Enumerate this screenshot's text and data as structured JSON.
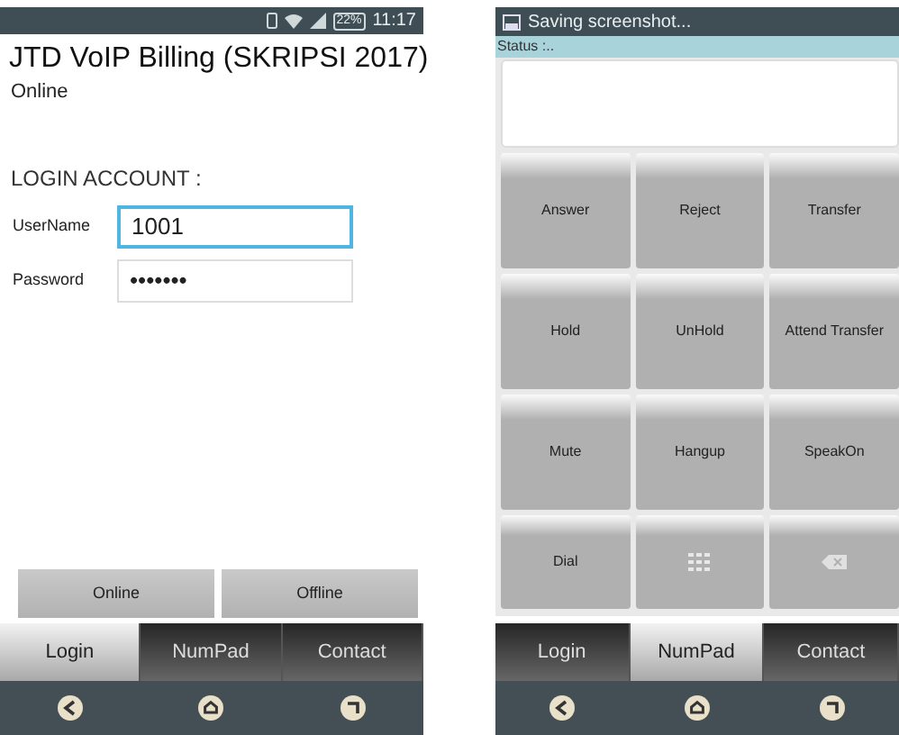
{
  "login_screen": {
    "status_bar": {
      "battery": "22%",
      "time": "11:17"
    },
    "title": "JTD VoIP Billing (SKRIPSI 2017)",
    "status": "Online",
    "section": "LOGIN ACCOUNT :",
    "fields": [
      {
        "label": "UserName",
        "value": "1001",
        "focused": true
      },
      {
        "label": "Password",
        "value": "•••••••",
        "focused": false
      }
    ],
    "buttons": [
      "Online",
      "Offline"
    ],
    "tabs": [
      {
        "label": "Login",
        "selected": true
      },
      {
        "label": "NumPad",
        "selected": false
      },
      {
        "label": "Contact",
        "selected": false
      }
    ]
  },
  "numpad_screen": {
    "status_bar": {
      "notification": "Saving screenshot..."
    },
    "status_label": "Status :..",
    "keys": [
      {
        "kind": "text",
        "label": "Answer"
      },
      {
        "kind": "text",
        "label": "Reject"
      },
      {
        "kind": "text",
        "label": "Transfer"
      },
      {
        "kind": "text",
        "label": "Hold"
      },
      {
        "kind": "text",
        "label": "UnHold"
      },
      {
        "kind": "text",
        "label": "Attend Transfer"
      },
      {
        "kind": "text",
        "label": "Mute"
      },
      {
        "kind": "text",
        "label": "Hangup"
      },
      {
        "kind": "text",
        "label": "SpeakOn"
      },
      {
        "kind": "text",
        "label": "Dial"
      },
      {
        "kind": "keypad"
      },
      {
        "kind": "backspace"
      }
    ],
    "tabs": [
      {
        "label": "Login",
        "selected": false
      },
      {
        "label": "NumPad",
        "selected": true
      },
      {
        "label": "Contact",
        "selected": false
      }
    ]
  }
}
